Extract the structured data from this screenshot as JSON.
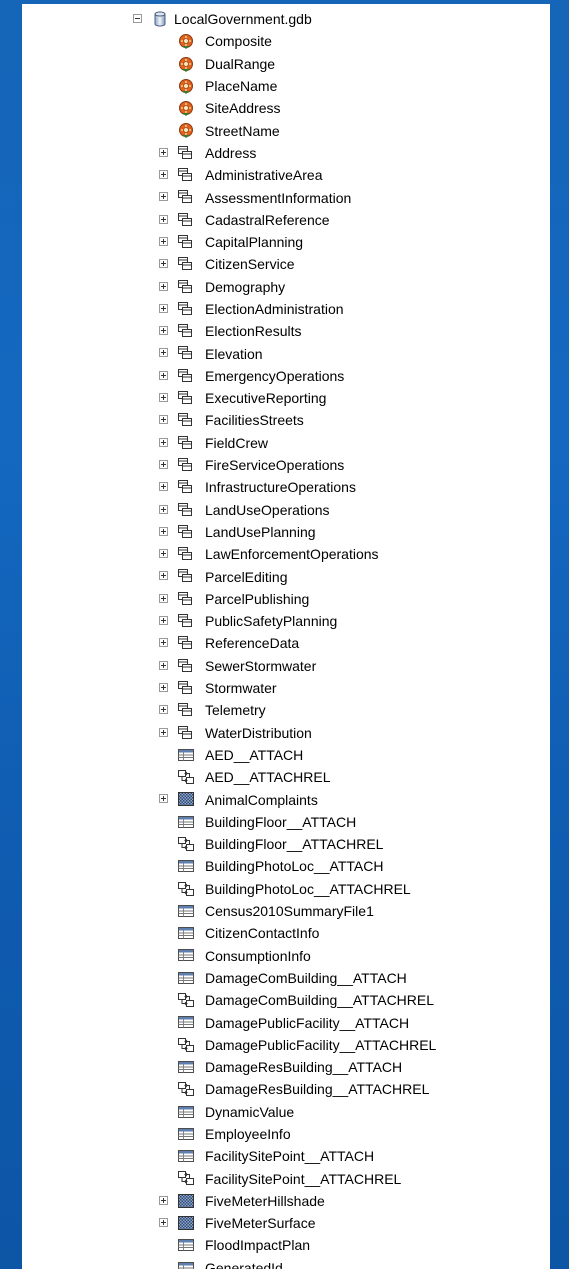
{
  "root": {
    "label": "LocalGovernment.gdb",
    "icon": "geodatabase-icon",
    "expanded": true
  },
  "items": [
    {
      "label": "Composite",
      "type": "locator",
      "expandable": false
    },
    {
      "label": "DualRange",
      "type": "locator",
      "expandable": false
    },
    {
      "label": "PlaceName",
      "type": "locator",
      "expandable": false
    },
    {
      "label": "SiteAddress",
      "type": "locator",
      "expandable": false
    },
    {
      "label": "StreetName",
      "type": "locator",
      "expandable": false
    },
    {
      "label": "Address",
      "type": "feature-dataset",
      "expandable": true
    },
    {
      "label": "AdministrativeArea",
      "type": "feature-dataset",
      "expandable": true
    },
    {
      "label": "AssessmentInformation",
      "type": "feature-dataset",
      "expandable": true
    },
    {
      "label": "CadastralReference",
      "type": "feature-dataset",
      "expandable": true
    },
    {
      "label": "CapitalPlanning",
      "type": "feature-dataset",
      "expandable": true
    },
    {
      "label": "CitizenService",
      "type": "feature-dataset",
      "expandable": true
    },
    {
      "label": "Demography",
      "type": "feature-dataset",
      "expandable": true
    },
    {
      "label": "ElectionAdministration",
      "type": "feature-dataset",
      "expandable": true
    },
    {
      "label": "ElectionResults",
      "type": "feature-dataset",
      "expandable": true
    },
    {
      "label": "Elevation",
      "type": "feature-dataset",
      "expandable": true
    },
    {
      "label": "EmergencyOperations",
      "type": "feature-dataset",
      "expandable": true
    },
    {
      "label": "ExecutiveReporting",
      "type": "feature-dataset",
      "expandable": true
    },
    {
      "label": "FacilitiesStreets",
      "type": "feature-dataset",
      "expandable": true
    },
    {
      "label": "FieldCrew",
      "type": "feature-dataset",
      "expandable": true
    },
    {
      "label": "FireServiceOperations",
      "type": "feature-dataset",
      "expandable": true
    },
    {
      "label": "InfrastructureOperations",
      "type": "feature-dataset",
      "expandable": true
    },
    {
      "label": "LandUseOperations",
      "type": "feature-dataset",
      "expandable": true
    },
    {
      "label": "LandUsePlanning",
      "type": "feature-dataset",
      "expandable": true
    },
    {
      "label": "LawEnforcementOperations",
      "type": "feature-dataset",
      "expandable": true
    },
    {
      "label": "ParcelEditing",
      "type": "feature-dataset",
      "expandable": true
    },
    {
      "label": "ParcelPublishing",
      "type": "feature-dataset",
      "expandable": true
    },
    {
      "label": "PublicSafetyPlanning",
      "type": "feature-dataset",
      "expandable": true
    },
    {
      "label": "ReferenceData",
      "type": "feature-dataset",
      "expandable": true
    },
    {
      "label": "SewerStormwater",
      "type": "feature-dataset",
      "expandable": true
    },
    {
      "label": "Stormwater",
      "type": "feature-dataset",
      "expandable": true
    },
    {
      "label": "Telemetry",
      "type": "feature-dataset",
      "expandable": true
    },
    {
      "label": "WaterDistribution",
      "type": "feature-dataset",
      "expandable": true
    },
    {
      "label": "AED__ATTACH",
      "type": "table",
      "expandable": false
    },
    {
      "label": "AED__ATTACHREL",
      "type": "relationship",
      "expandable": false
    },
    {
      "label": "AnimalComplaints",
      "type": "raster",
      "expandable": true
    },
    {
      "label": "BuildingFloor__ATTACH",
      "type": "table",
      "expandable": false
    },
    {
      "label": "BuildingFloor__ATTACHREL",
      "type": "relationship",
      "expandable": false
    },
    {
      "label": "BuildingPhotoLoc__ATTACH",
      "type": "table",
      "expandable": false
    },
    {
      "label": "BuildingPhotoLoc__ATTACHREL",
      "type": "relationship",
      "expandable": false
    },
    {
      "label": "Census2010SummaryFile1",
      "type": "table",
      "expandable": false
    },
    {
      "label": "CitizenContactInfo",
      "type": "table",
      "expandable": false
    },
    {
      "label": "ConsumptionInfo",
      "type": "table",
      "expandable": false
    },
    {
      "label": "DamageComBuilding__ATTACH",
      "type": "table",
      "expandable": false
    },
    {
      "label": "DamageComBuilding__ATTACHREL",
      "type": "relationship",
      "expandable": false
    },
    {
      "label": "DamagePublicFacility__ATTACH",
      "type": "table",
      "expandable": false
    },
    {
      "label": "DamagePublicFacility__ATTACHREL",
      "type": "relationship",
      "expandable": false
    },
    {
      "label": "DamageResBuilding__ATTACH",
      "type": "table",
      "expandable": false
    },
    {
      "label": "DamageResBuilding__ATTACHREL",
      "type": "relationship",
      "expandable": false
    },
    {
      "label": "DynamicValue",
      "type": "table",
      "expandable": false
    },
    {
      "label": "EmployeeInfo",
      "type": "table",
      "expandable": false
    },
    {
      "label": "FacilitySitePoint__ATTACH",
      "type": "table",
      "expandable": false
    },
    {
      "label": "FacilitySitePoint__ATTACHREL",
      "type": "relationship",
      "expandable": false
    },
    {
      "label": "FiveMeterHillshade",
      "type": "raster",
      "expandable": true
    },
    {
      "label": "FiveMeterSurface",
      "type": "raster",
      "expandable": true
    },
    {
      "label": "FloodImpactPlan",
      "type": "table",
      "expandable": false
    },
    {
      "label": "GeneratedId",
      "type": "table",
      "expandable": false
    }
  ]
}
